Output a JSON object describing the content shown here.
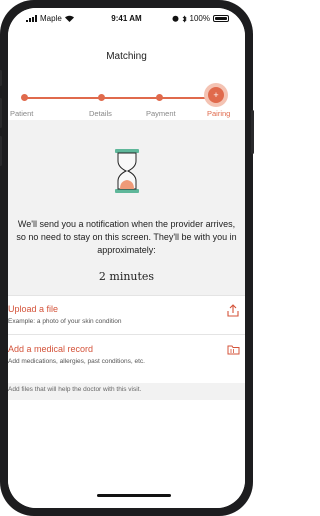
{
  "status_bar": {
    "carrier": "Maple",
    "time": "9:41 AM",
    "battery": "100%"
  },
  "nav": {
    "title": "Matching"
  },
  "steps": [
    {
      "label": "Patient",
      "state": "done"
    },
    {
      "label": "Details",
      "state": "done"
    },
    {
      "label": "Payment",
      "state": "done"
    },
    {
      "label": "Pairing",
      "state": "active"
    }
  ],
  "waiting": {
    "message": "We'll send you a notification when the provider arrives, so no need to stay on this screen. They'll be with you in approximately:",
    "eta": "2 minutes"
  },
  "actions": [
    {
      "title": "Upload a file",
      "subtitle": "Example: a photo of your skin condition",
      "icon": "upload-icon"
    },
    {
      "title": "Add a medical record",
      "subtitle": "Add medications, allergies, past conditions, etc.",
      "icon": "folder-icon"
    }
  ],
  "footer_note": "Add files that will help the doctor with this visit.",
  "colors": {
    "accent": "#e06a4c",
    "accent_light": "#f4c3b3",
    "hourglass_frame": "#5fb79a"
  }
}
